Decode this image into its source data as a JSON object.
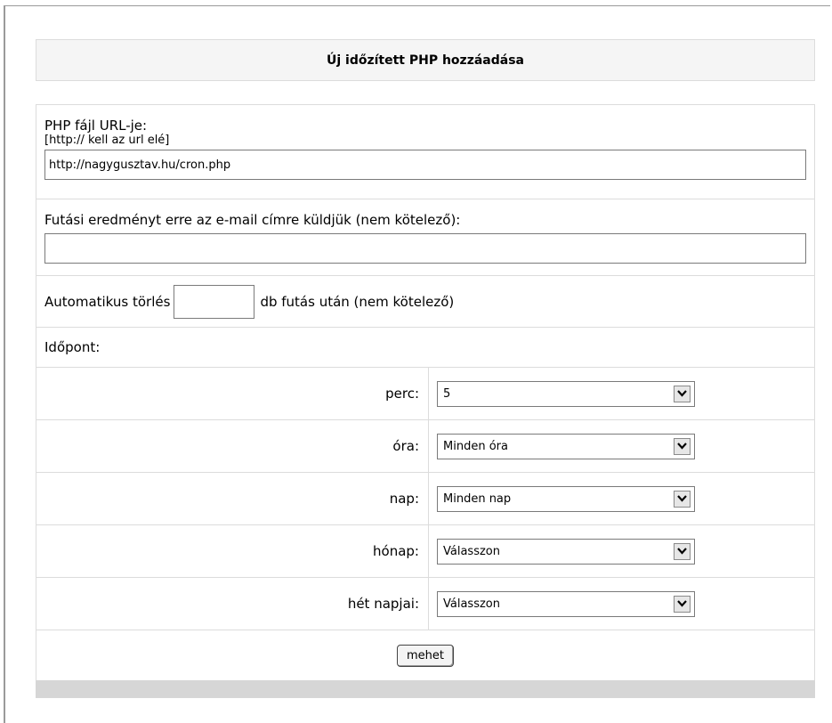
{
  "header": {
    "title": "Új időzített PHP hozzáadása"
  },
  "url_section": {
    "label": "PHP fájl URL-je:",
    "hint": "[http:// kell az url elé]",
    "value": "http://nagygusztav.hu/cron.php"
  },
  "email_section": {
    "label": "Futási eredményt erre az e-mail címre küldjük (nem kötelező):",
    "value": ""
  },
  "delete_section": {
    "prefix": "Automatikus törlés",
    "value": "",
    "suffix": "db futás után (nem kötelező)"
  },
  "time_section": {
    "label": "Időpont:"
  },
  "schedule": [
    {
      "label": "perc:",
      "value": "5"
    },
    {
      "label": "óra:",
      "value": "Minden óra"
    },
    {
      "label": "nap:",
      "value": "Minden nap"
    },
    {
      "label": "hónap:",
      "value": "Válasszon"
    },
    {
      "label": "hét napjai:",
      "value": "Válasszon"
    }
  ],
  "submit": {
    "label": "mehet"
  }
}
